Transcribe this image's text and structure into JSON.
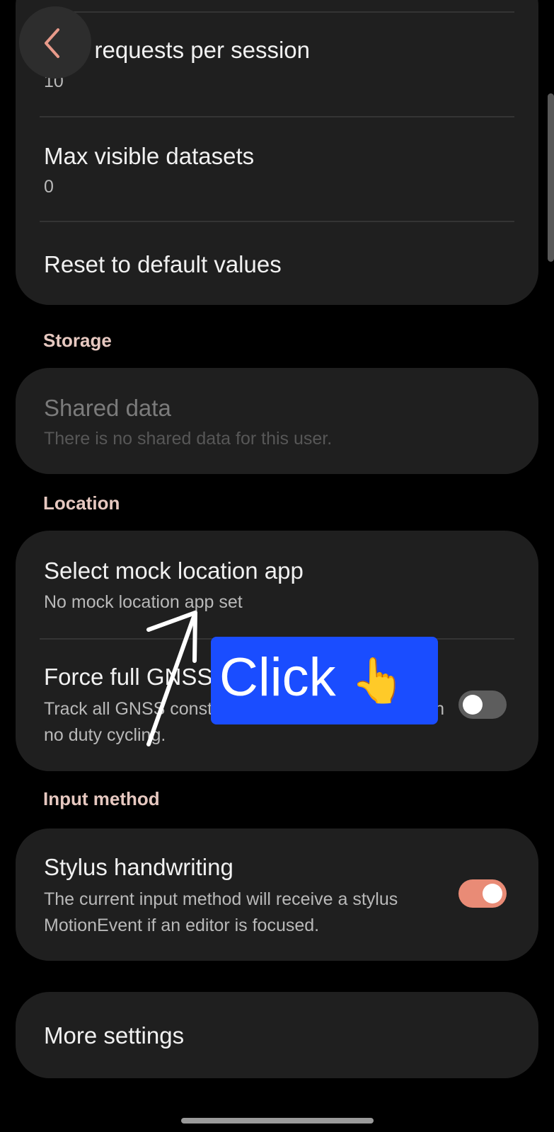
{
  "top_card": {
    "rows": [
      {
        "title": "Max requests per session",
        "value": "10"
      },
      {
        "title": "Max visible datasets",
        "value": "0"
      },
      {
        "title": "Reset to default values"
      }
    ]
  },
  "sections": {
    "storage": {
      "header": "Storage",
      "shared_data": {
        "title": "Shared data",
        "subtitle": "There is no shared data for this user."
      }
    },
    "location": {
      "header": "Location",
      "mock_location": {
        "title": "Select mock location app",
        "subtitle": "No mock location app set"
      },
      "force_gnss": {
        "title": "Force full GNSS measurements",
        "subtitle": "Track all GNSS constellations and frequencies with no duty cycling.",
        "enabled": false
      }
    },
    "input_method": {
      "header": "Input method",
      "stylus": {
        "title": "Stylus handwriting",
        "subtitle": "The current input method will receive a stylus MotionEvent if an editor is focused.",
        "enabled": true
      }
    },
    "more": {
      "title": "More settings"
    }
  },
  "overlay": {
    "click_label": "Click",
    "click_emoji": "👆",
    "badge_color": "#1a4dff"
  },
  "icons": {
    "back": "chevron-left-icon"
  },
  "colors": {
    "toggle_on": "#e98b76",
    "toggle_off": "#5d5d5d",
    "section_header": "#e6c8c0"
  }
}
